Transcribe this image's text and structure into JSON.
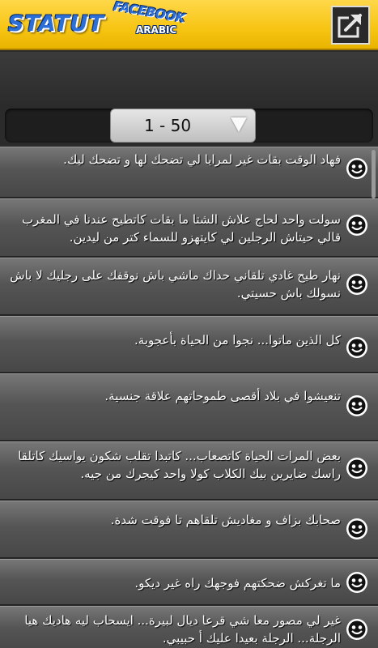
{
  "header": {
    "logo_main": "STATUT",
    "logo_facebook": "FACEBOOK",
    "logo_arabic": "ARABIC",
    "share_icon": "share-out-icon"
  },
  "pager": {
    "range": "1 - 50",
    "arrow_icon": "dropdown-triangle-icon"
  },
  "statuses": [
    {
      "text": "فهاد الوقت بقات غير لمرايا لي تضحك لها و تضحك ليك.",
      "icon": "smiley-icon"
    },
    {
      "text": "سولت واحد لحاج علاش الشتا ما بقات كاتطيح عندنا في المغرب قالي حيتاش الرجلين لي كايتهزو للسماء كتر من ليدين.",
      "icon": "smiley-icon"
    },
    {
      "text": "نهار طيح غادي تلقاني حداك ماشي باش نوقفك على رجليك لا باش نسولك باش حسيتي.",
      "icon": "smiley-icon"
    },
    {
      "text": "كل الذين ماتوا... نجوا من الحياة بأعجوبة.",
      "icon": "smiley-icon"
    },
    {
      "text": "تنعيشوا في بلاد أقصى طموحاتهم علاقة جنسية.",
      "icon": "smiley-icon"
    },
    {
      "text": "بعض المرات الحياة كاتصعاب... كاتبدا تقلب شكون يواسيك كاتلقا راسك ضايرين بيك الكلاب كولا واحد كيجرك من جيه.",
      "icon": "smiley-icon"
    },
    {
      "text": "صحابك بزاف و مغاديش تلقاهم تا فوقت شدة.",
      "icon": "smiley-icon"
    },
    {
      "text": "ما تغركش ضحكتهم فوجهك راه غير ديكو.",
      "icon": "smiley-icon"
    },
    {
      "text": "غير لي مصور معا شي قرعا ديال لبيرة... ايسحاب ليه هاديك هيا الرجلة... الرجلة بعيدا عليك أ حبيبي.",
      "icon": "smiley-icon"
    }
  ],
  "colors": {
    "header_yellow": "#f6c412",
    "logo_blue": "#2c6fd6",
    "row_gray": "#555555"
  }
}
